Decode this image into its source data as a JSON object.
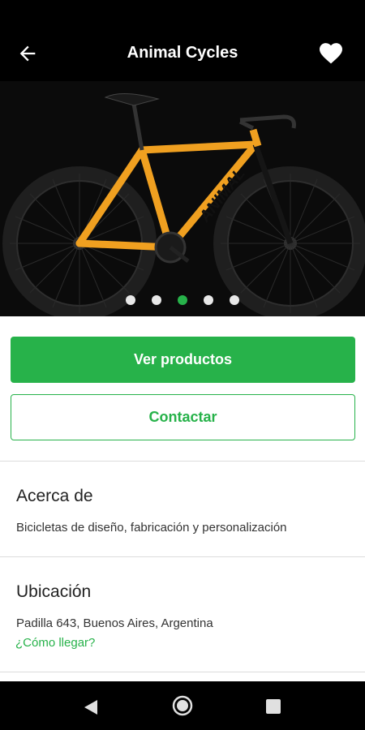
{
  "app": {
    "title": "Animal Cycles"
  },
  "hero": {
    "brand_text": "ANIMAL",
    "carousel_pages": 5,
    "active_page": 3
  },
  "actions": {
    "primary_label": "Ver productos",
    "secondary_label": "Contactar"
  },
  "about": {
    "title": "Acerca de",
    "text": "Bicicletas de diseño, fabricación y personalización"
  },
  "location": {
    "title": "Ubicación",
    "address": "Padilla 643, Buenos Aires, Argentina",
    "link_label": "¿Cómo llegar?"
  },
  "icons": {
    "back": "arrow-left-icon",
    "favorite": "heart-icon",
    "nav_back": "triangle-back-icon",
    "nav_home": "circle-home-icon",
    "nav_recent": "square-recent-icon"
  },
  "colors": {
    "accent": "#27b24a",
    "appbar": "#000000"
  }
}
